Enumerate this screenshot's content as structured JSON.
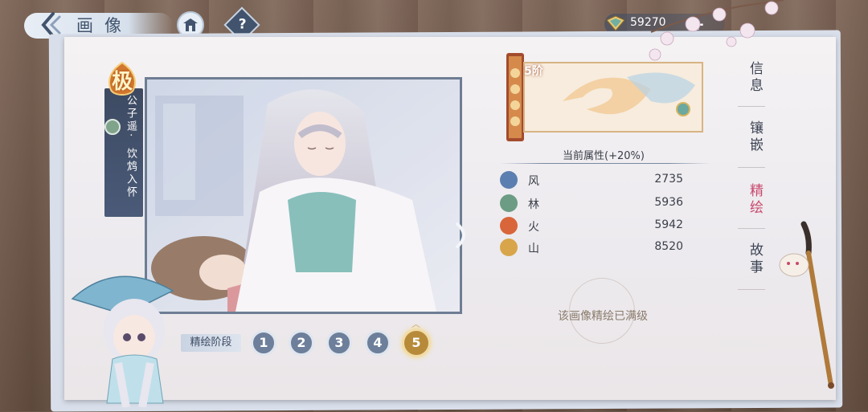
{
  "header": {
    "title": "画像",
    "help_label": "?"
  },
  "currency": {
    "amount": "59270",
    "add_label": "+"
  },
  "card": {
    "rank_badge": "极",
    "name_line1": "公子遥·",
    "name_line2": "饮鸩入怀"
  },
  "stages": {
    "label": "精绘阶段",
    "items": [
      "1",
      "2",
      "3",
      "4",
      "5"
    ],
    "active": "5"
  },
  "tier": "5阶",
  "attributes": {
    "title": "当前属性(+20%)",
    "rows": [
      {
        "name": "风",
        "value": "2735",
        "icon": "wind-icon",
        "color": "#5b7fb0"
      },
      {
        "name": "林",
        "value": "5936",
        "icon": "tree-icon",
        "color": "#6c9c84"
      },
      {
        "name": "火",
        "value": "5942",
        "icon": "fire-icon",
        "color": "#d9653a"
      },
      {
        "name": "山",
        "value": "8520",
        "icon": "mountain-icon",
        "color": "#d8a54a"
      }
    ]
  },
  "maxed_text": "该画像精绘已满级",
  "tabs": [
    {
      "label": "信息",
      "active": false
    },
    {
      "label": "镶嵌",
      "active": false
    },
    {
      "label": "精绘",
      "active": true
    },
    {
      "label": "故事",
      "active": false
    }
  ]
}
